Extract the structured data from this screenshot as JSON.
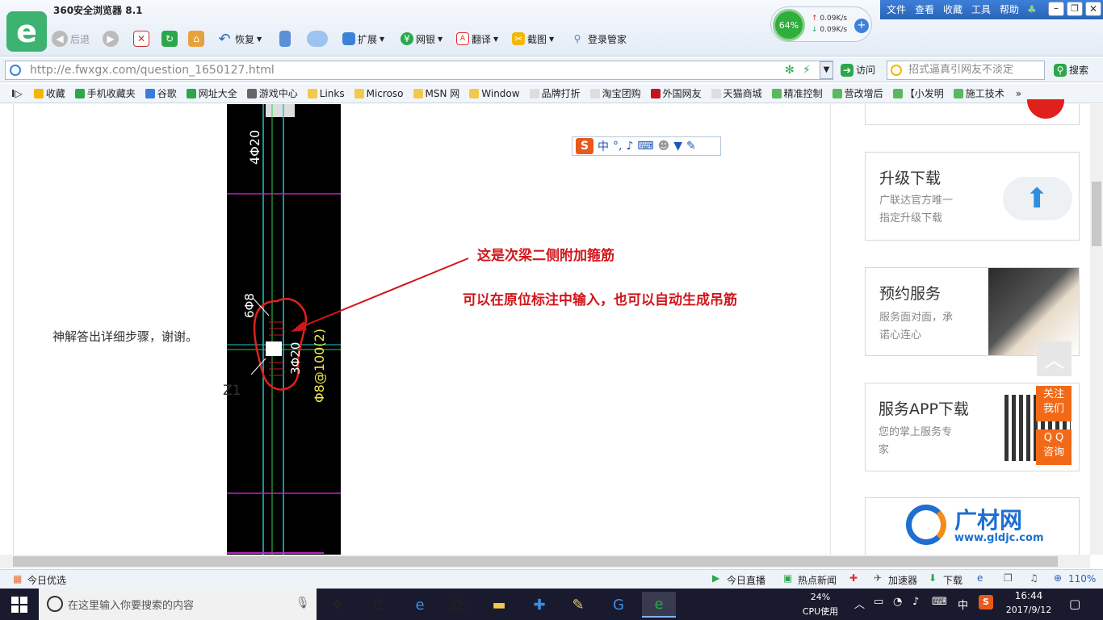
{
  "browser": {
    "title": "360安全浏览器 8.1",
    "menu": [
      "文件",
      "查看",
      "收藏",
      "工具",
      "帮助"
    ],
    "toolbar": {
      "back": "后退",
      "restore": "恢复",
      "extend": "扩展",
      "bank": "网银",
      "translate": "翻译",
      "screenshot": "截图",
      "login": "登录管家"
    },
    "speed": {
      "percent": "64%",
      "up": "0.09K/s",
      "down": "0.09K/s"
    },
    "address": "http://e.fwxgx.com/question_1650127.html",
    "visit": "访问",
    "search_placeholder": "招式逼真引网友不淡定",
    "search_button": "搜索"
  },
  "bookmarks": [
    {
      "label": "收藏",
      "color": "#f2b705"
    },
    {
      "label": "手机收藏夹",
      "color": "#2aa84a"
    },
    {
      "label": "谷歌",
      "color": "#3b7be0"
    },
    {
      "label": "网址大全",
      "color": "#2aa84a"
    },
    {
      "label": "游戏中心",
      "color": "#666666"
    },
    {
      "label": "Links",
      "color": "#f2c94c"
    },
    {
      "label": "Microso",
      "color": "#f2c94c"
    },
    {
      "label": "MSN 网",
      "color": "#f2c94c"
    },
    {
      "label": "Window",
      "color": "#f2c94c"
    },
    {
      "label": "品牌打折",
      "color": "#dddddd"
    },
    {
      "label": "淘宝团购",
      "color": "#dddddd"
    },
    {
      "label": "外国网友",
      "color": "#c0161b"
    },
    {
      "label": "天猫商城",
      "color": "#dddddd"
    },
    {
      "label": "精准控制",
      "color": "#5cb85c"
    },
    {
      "label": "营改增后",
      "color": "#5cb85c"
    },
    {
      "label": "【小发明",
      "color": "#5cb85c"
    },
    {
      "label": "施工技术",
      "color": "#5cb85c"
    }
  ],
  "content": {
    "question": "神解答出详细步骤，谢谢。",
    "annotation1": "这是次梁二侧附加箍筋",
    "annotation2": "可以在原位标注中输入，也可以自动生成吊筋",
    "cad_labels": [
      "4Φ20",
      "6Φ8",
      "3Φ20",
      "Φ8@100(2)",
      "Z1"
    ]
  },
  "ime": {
    "label": "中"
  },
  "sidebar": {
    "upgrade": {
      "title": "升级下载",
      "desc": [
        "广联达官方唯一",
        "指定升级下载"
      ]
    },
    "appointment": {
      "title": "预约服务",
      "desc": [
        "服务面对面，承",
        "诺心连心"
      ]
    },
    "app": {
      "title": "服务APP下载",
      "desc": [
        "您的掌上服务专",
        "家"
      ]
    },
    "brand": {
      "name": "广材网",
      "url": "www.gldjc.com"
    },
    "follow": [
      "关注",
      "我们"
    ],
    "qq": [
      "Q Q",
      "咨询"
    ]
  },
  "status_bar": {
    "left": "今日优选",
    "live": "今日直播",
    "news": "热点新闻",
    "accelerator": "加速器",
    "download": "下载",
    "zoom": "110%"
  },
  "taskbar": {
    "search_placeholder": "在这里输入你要搜索的内容",
    "cpu_percent": "24%",
    "cpu_label": "CPU使用",
    "ime": "中",
    "time": "16:44",
    "date": "2017/9/12"
  }
}
